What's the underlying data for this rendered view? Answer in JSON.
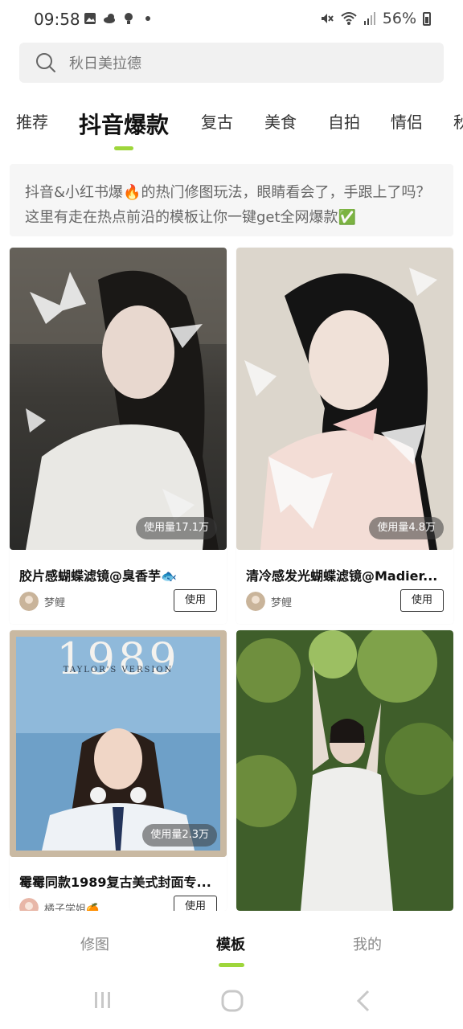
{
  "status_bar": {
    "time": "09:58",
    "battery": "56%",
    "icons": [
      "gallery-icon",
      "weather-icon",
      "bulb-icon",
      "dot-icon",
      "mute-icon",
      "wifi-icon",
      "signal-icon",
      "battery-icon"
    ]
  },
  "search": {
    "placeholder": "秋日美拉德"
  },
  "tabs": [
    {
      "label": "推荐",
      "active": false
    },
    {
      "label": "抖音爆款",
      "active": true
    },
    {
      "label": "复古",
      "active": false
    },
    {
      "label": "美食",
      "active": false
    },
    {
      "label": "自拍",
      "active": false
    },
    {
      "label": "情侣",
      "active": false
    },
    {
      "label": "秋",
      "active": false
    }
  ],
  "description": "抖音&小红书爆🔥的热门修图玩法，眼睛看会了，手跟上了吗？这里有走在热点前沿的模板让你一键get全网爆款✅",
  "cards": [
    {
      "title": "胶片感蝴蝶滤镜@臭香芋🐟",
      "usage": "使用量17.1万",
      "author": "梦鲤",
      "button": "使用"
    },
    {
      "title": "清冷感发光蝴蝶滤镜@Madier...",
      "usage": "使用量4.8万",
      "author": "梦鲤",
      "button": "使用"
    },
    {
      "title": "霉霉同款1989复古美式封面专...",
      "usage": "使用量2.3万",
      "author": "橘子学姐🍊",
      "button": "使用",
      "cover_text": "1989",
      "cover_subtext": "TAYLOR'S VERSION"
    },
    {
      "title": "",
      "usage": "",
      "author": "",
      "button": ""
    }
  ],
  "bottom_nav": [
    {
      "label": "修图",
      "active": false
    },
    {
      "label": "模板",
      "active": true
    },
    {
      "label": "我的",
      "active": false
    }
  ],
  "colors": {
    "accent": "#9ed63b",
    "search_bg": "#f1f1f1",
    "desc_bg": "#f6f6f6"
  }
}
